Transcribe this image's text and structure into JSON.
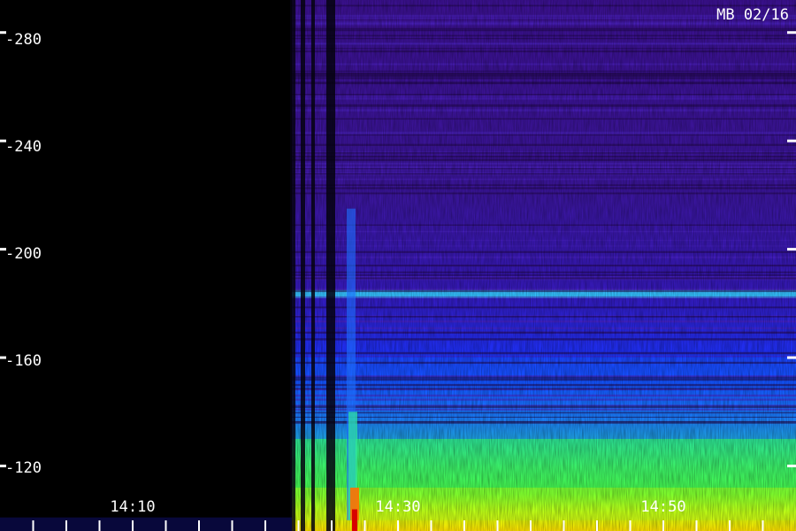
{
  "chart_data": {
    "type": "heatmap",
    "title": "MB 02/16",
    "x_tick_labels": [
      "14:10",
      "14:30",
      "14:50"
    ],
    "y_ticks": [
      280,
      240,
      200,
      160,
      120
    ],
    "y_tick_labels": [
      "-280",
      "-240",
      "-200",
      "-160",
      "-120"
    ],
    "y_range": [
      96,
      292
    ],
    "x_range": [
      "14:02",
      "14:62"
    ],
    "minor_tick_interval_minutes": 2.5,
    "grid": false,
    "colormap": [
      "#000000",
      "#3a0f90",
      "#2b1fd0",
      "#0000ff",
      "#1f7dff",
      "#34c0ff",
      "#2fe7a0",
      "#4cff3a",
      "#c8ff00",
      "#ffe000",
      "#ff7000",
      "#d80000"
    ],
    "events": [
      {
        "label": "noise onset",
        "time": "14:24"
      },
      {
        "label": "data gap",
        "time": "14:27"
      },
      {
        "label": "burst",
        "time": "14:28"
      }
    ],
    "bands": [
      {
        "freq_low": 182,
        "freq_high": 185,
        "intensity": "cyan"
      },
      {
        "freq_low": 100,
        "freq_high": 112,
        "intensity": "yellow-green"
      },
      {
        "freq_low": 112,
        "freq_high": 130,
        "intensity": "green"
      },
      {
        "freq_low": 130,
        "freq_high": 160,
        "intensity": "blue"
      }
    ]
  }
}
